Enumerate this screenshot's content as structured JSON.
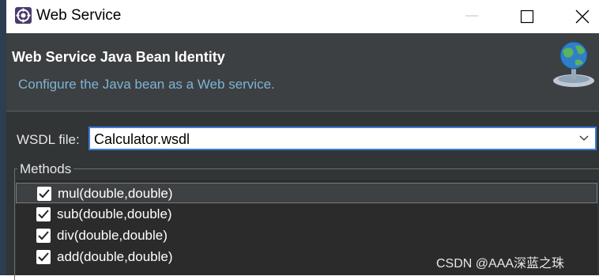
{
  "window": {
    "title": "Web Service"
  },
  "header": {
    "title": "Web Service Java Bean Identity",
    "description": "Configure the Java bean as a Web service."
  },
  "wsdl": {
    "label": "WSDL file:",
    "value": "Calculator.wsdl"
  },
  "methods": {
    "legend": "Methods",
    "items": [
      {
        "label": "mul(double,double)",
        "checked": true,
        "selected": true
      },
      {
        "label": "sub(double,double)",
        "checked": true,
        "selected": false
      },
      {
        "label": "div(double,double)",
        "checked": true,
        "selected": false
      },
      {
        "label": "add(double,double)",
        "checked": true,
        "selected": false
      }
    ]
  },
  "watermark": "CSDN @AAA深蓝之珠",
  "colors": {
    "header_bg": "#3c4042",
    "body_bg": "#323536",
    "list_bg": "#2b2b2b",
    "description": "#7fb3d4",
    "focus_border": "#3d7bd9"
  },
  "icons": [
    "eclipse-app-icon",
    "minimize-icon",
    "maximize-icon",
    "close-icon",
    "web-service-globe-icon",
    "chevron-down-icon",
    "checkmark-icon"
  ]
}
